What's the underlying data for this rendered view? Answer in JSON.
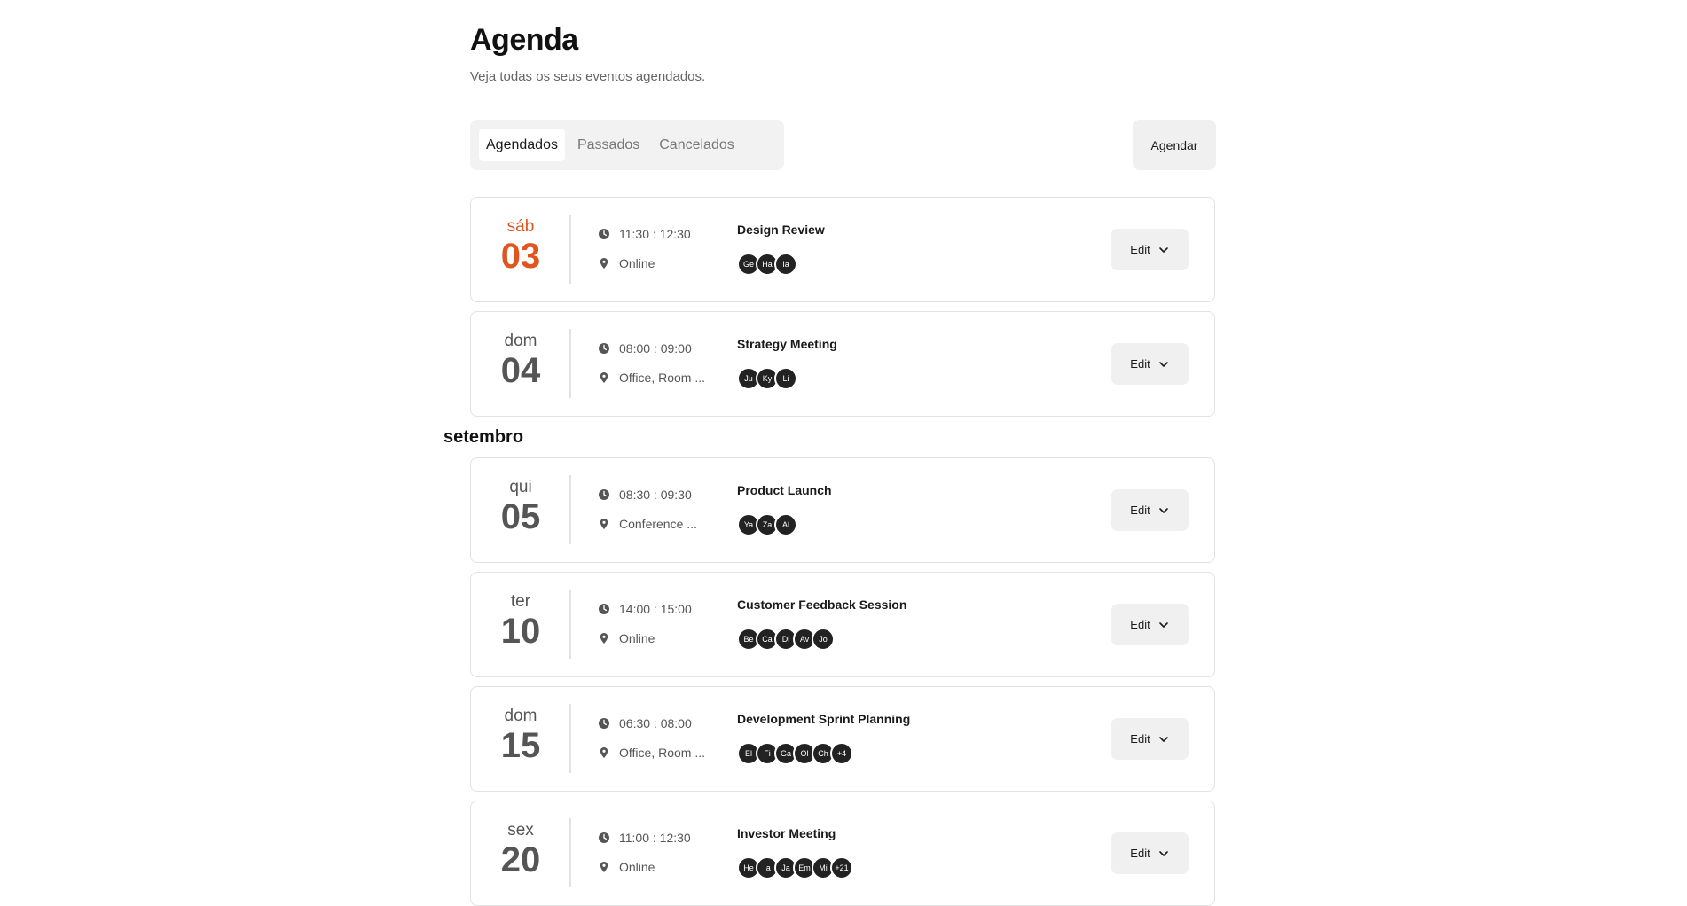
{
  "header": {
    "title": "Agenda",
    "subtitle": "Veja todas os seus eventos agendados."
  },
  "tabs": [
    {
      "label": "Agendados",
      "active": true
    },
    {
      "label": "Passados",
      "active": false
    },
    {
      "label": "Cancelados",
      "active": false
    }
  ],
  "schedule_button": "Agendar",
  "month_label": "setembro",
  "edit_label": "Edit",
  "icons": {
    "time": "clock-icon",
    "location": "map-pin-icon",
    "edit_dropdown": "chevron-down-icon"
  },
  "colors": {
    "highlight": "#e0541d",
    "avatar": "#222222"
  },
  "events": [
    {
      "weekday": "sáb",
      "day": "03",
      "time": "11:30 : 12:30",
      "location": "Online",
      "title": "Design Review",
      "attendees": [
        "Ge",
        "Ha",
        "Ia"
      ]
    },
    {
      "weekday": "dom",
      "day": "04",
      "time": "08:00 : 09:00",
      "location": "Office, Room ...",
      "title": "Strategy Meeting",
      "attendees": [
        "Ju",
        "Ky",
        "Li"
      ]
    },
    {
      "weekday": "qui",
      "day": "05",
      "time": "08:30 : 09:30",
      "location": "Conference ...",
      "title": "Product Launch",
      "attendees": [
        "Ya",
        "Za",
        "Al"
      ]
    },
    {
      "weekday": "ter",
      "day": "10",
      "time": "14:00 : 15:00",
      "location": "Online",
      "title": "Customer Feedback Session",
      "attendees": [
        "Be",
        "Ca",
        "Di",
        "Av",
        "Jo"
      ]
    },
    {
      "weekday": "dom",
      "day": "15",
      "time": "06:30 : 08:00",
      "location": "Office, Room ...",
      "title": "Development Sprint Planning",
      "attendees": [
        "El",
        "Fi",
        "Ga",
        "Ol",
        "Ch",
        "+4"
      ]
    },
    {
      "weekday": "sex",
      "day": "20",
      "time": "11:00 : 12:30",
      "location": "Online",
      "title": "Investor Meeting",
      "attendees": [
        "He",
        "Ia",
        "Ja",
        "Em",
        "Mi",
        "+21"
      ]
    }
  ]
}
